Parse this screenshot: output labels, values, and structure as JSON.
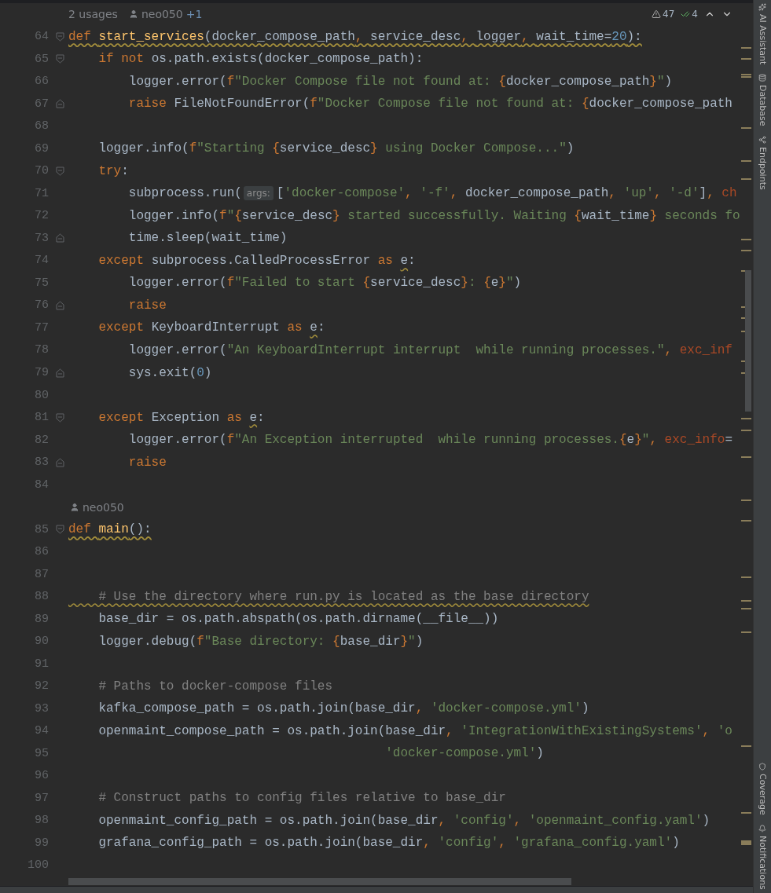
{
  "header": {
    "usages": "2 usages",
    "author": "neo050",
    "coauthors": "+1"
  },
  "inspections": {
    "warnings": "47",
    "ok": "4"
  },
  "lines": [
    {
      "kind": "code",
      "n": "64",
      "fold": {
        "kind": "start"
      },
      "wavy": true,
      "tokens": [
        {
          "kind": "kw",
          "text": "def "
        },
        {
          "kind": "fn",
          "text": "start_services"
        },
        {
          "kind": "p",
          "text": "(docker_compose_path"
        },
        {
          "kind": "kw",
          "text": ", "
        },
        {
          "kind": "p",
          "text": "service_desc"
        },
        {
          "kind": "kw",
          "text": ", "
        },
        {
          "kind": "p",
          "text": "logger"
        },
        {
          "kind": "kw",
          "text": ", "
        },
        {
          "kind": "p",
          "text": "wait_time="
        },
        {
          "kind": "num",
          "text": "20"
        },
        {
          "kind": "p",
          "text": "):"
        }
      ]
    },
    {
      "kind": "code",
      "n": "65",
      "fold": {
        "kind": "start"
      },
      "tokens": [
        {
          "kind": "kw",
          "text": "    if not "
        },
        {
          "kind": "p",
          "text": "os.path.exists(docker_compose_path):"
        }
      ]
    },
    {
      "kind": "code",
      "n": "66",
      "tokens": [
        {
          "kind": "p",
          "text": "        logger.error("
        },
        {
          "kind": "kw",
          "text": "f"
        },
        {
          "kind": "str",
          "text": "\"Docker Compose file not found at: "
        },
        {
          "kind": "kw",
          "text": "{"
        },
        {
          "kind": "p",
          "text": "docker_compose_path"
        },
        {
          "kind": "kw",
          "text": "}"
        },
        {
          "kind": "str",
          "text": "\""
        },
        {
          "kind": "p",
          "text": ")"
        }
      ]
    },
    {
      "kind": "code",
      "n": "67",
      "fold": {
        "kind": "end"
      },
      "tokens": [
        {
          "kind": "kw",
          "text": "        raise "
        },
        {
          "kind": "p",
          "text": "FileNotFoundError("
        },
        {
          "kind": "kw",
          "text": "f"
        },
        {
          "kind": "str",
          "text": "\"Docker Compose file not found at: "
        },
        {
          "kind": "kw",
          "text": "{"
        },
        {
          "kind": "p",
          "text": "docker_compose_path"
        }
      ]
    },
    {
      "kind": "code",
      "n": "68"
    },
    {
      "kind": "code",
      "n": "69",
      "tokens": [
        {
          "kind": "p",
          "text": "    logger.info("
        },
        {
          "kind": "kw",
          "text": "f"
        },
        {
          "kind": "str",
          "text": "\"Starting "
        },
        {
          "kind": "kw",
          "text": "{"
        },
        {
          "kind": "p",
          "text": "service_desc"
        },
        {
          "kind": "kw",
          "text": "}"
        },
        {
          "kind": "str",
          "text": " using Docker Compose...\""
        },
        {
          "kind": "p",
          "text": ")"
        }
      ]
    },
    {
      "kind": "code",
      "n": "70",
      "fold": {
        "kind": "start"
      },
      "tokens": [
        {
          "kind": "kw",
          "text": "    try"
        },
        {
          "kind": "p",
          "text": ":"
        }
      ]
    },
    {
      "kind": "code",
      "n": "71",
      "tokens": [
        {
          "kind": "p",
          "text": "        subprocess.run("
        },
        {
          "kind": "hint",
          "text": "args:"
        },
        {
          "kind": "p",
          "text": "["
        },
        {
          "kind": "str",
          "text": "'docker-compose'"
        },
        {
          "kind": "kw",
          "text": ", "
        },
        {
          "kind": "str",
          "text": "'-f'"
        },
        {
          "kind": "kw",
          "text": ", "
        },
        {
          "kind": "p",
          "text": "docker_compose_path"
        },
        {
          "kind": "kw",
          "text": ", "
        },
        {
          "kind": "str",
          "text": "'up'"
        },
        {
          "kind": "kw",
          "text": ", "
        },
        {
          "kind": "str",
          "text": "'-d'"
        },
        {
          "kind": "p",
          "text": "]"
        },
        {
          "kind": "kw",
          "text": ", "
        },
        {
          "kind": "kwarg",
          "text": "ch"
        }
      ]
    },
    {
      "kind": "code",
      "n": "72",
      "tokens": [
        {
          "kind": "p",
          "text": "        logger.info("
        },
        {
          "kind": "kw",
          "text": "f"
        },
        {
          "kind": "str",
          "text": "\""
        },
        {
          "kind": "kw",
          "text": "{"
        },
        {
          "kind": "p",
          "text": "service_desc"
        },
        {
          "kind": "kw",
          "text": "}"
        },
        {
          "kind": "str",
          "text": " started successfully. Waiting "
        },
        {
          "kind": "kw",
          "text": "{"
        },
        {
          "kind": "p",
          "text": "wait_time"
        },
        {
          "kind": "kw",
          "text": "}"
        },
        {
          "kind": "str",
          "text": " seconds fo"
        }
      ]
    },
    {
      "kind": "code",
      "n": "73",
      "fold": {
        "kind": "end"
      },
      "tokens": [
        {
          "kind": "p",
          "text": "        time.sleep(wait_time)"
        }
      ]
    },
    {
      "kind": "code",
      "n": "74",
      "tokens": [
        {
          "kind": "kw",
          "text": "    except "
        },
        {
          "kind": "p",
          "text": "subprocess.CalledProcessError "
        },
        {
          "kind": "kw",
          "text": "as "
        },
        {
          "kind": "p",
          "text": "e",
          "wavy": true
        },
        {
          "kind": "p",
          "text": ":"
        }
      ]
    },
    {
      "kind": "code",
      "n": "75",
      "tokens": [
        {
          "kind": "p",
          "text": "        logger.error("
        },
        {
          "kind": "kw",
          "text": "f"
        },
        {
          "kind": "str",
          "text": "\"Failed to start "
        },
        {
          "kind": "kw",
          "text": "{"
        },
        {
          "kind": "p",
          "text": "service_desc"
        },
        {
          "kind": "kw",
          "text": "}"
        },
        {
          "kind": "str",
          "text": ": "
        },
        {
          "kind": "kw",
          "text": "{"
        },
        {
          "kind": "p",
          "text": "e"
        },
        {
          "kind": "kw",
          "text": "}"
        },
        {
          "kind": "str",
          "text": "\""
        },
        {
          "kind": "p",
          "text": ")"
        }
      ]
    },
    {
      "kind": "code",
      "n": "76",
      "fold": {
        "kind": "end"
      },
      "tokens": [
        {
          "kind": "kw",
          "text": "        raise"
        }
      ]
    },
    {
      "kind": "code",
      "n": "77",
      "tokens": [
        {
          "kind": "kw",
          "text": "    except "
        },
        {
          "kind": "p",
          "text": "KeyboardInterrupt "
        },
        {
          "kind": "kw",
          "text": "as "
        },
        {
          "kind": "p",
          "text": "e",
          "wavy": true
        },
        {
          "kind": "p",
          "text": ":"
        }
      ]
    },
    {
      "kind": "code",
      "n": "78",
      "tokens": [
        {
          "kind": "p",
          "text": "        logger.error("
        },
        {
          "kind": "str",
          "text": "\"An KeyboardInterrupt interrupt  while running processes.\""
        },
        {
          "kind": "kw",
          "text": ", "
        },
        {
          "kind": "kwarg",
          "text": "exc_inf"
        }
      ]
    },
    {
      "kind": "code",
      "n": "79",
      "fold": {
        "kind": "end"
      },
      "tokens": [
        {
          "kind": "p",
          "text": "        sys.exit("
        },
        {
          "kind": "num",
          "text": "0"
        },
        {
          "kind": "p",
          "text": ")"
        }
      ]
    },
    {
      "kind": "code",
      "n": "80"
    },
    {
      "kind": "code",
      "n": "81",
      "fold": {
        "kind": "start"
      },
      "tokens": [
        {
          "kind": "kw",
          "text": "    except "
        },
        {
          "kind": "p",
          "text": "Exception "
        },
        {
          "kind": "kw",
          "text": "as "
        },
        {
          "kind": "p",
          "text": "e",
          "wavy": true
        },
        {
          "kind": "p",
          "text": ":"
        }
      ]
    },
    {
      "kind": "code",
      "n": "82",
      "tokens": [
        {
          "kind": "p",
          "text": "        logger.error("
        },
        {
          "kind": "kw",
          "text": "f"
        },
        {
          "kind": "str",
          "text": "\"An Exception interrupted  while running processes."
        },
        {
          "kind": "kw",
          "text": "{"
        },
        {
          "kind": "p",
          "text": "e"
        },
        {
          "kind": "kw",
          "text": "}"
        },
        {
          "kind": "str",
          "text": "\""
        },
        {
          "kind": "kw",
          "text": ", "
        },
        {
          "kind": "kwarg",
          "text": "exc_info"
        },
        {
          "kind": "p",
          "text": "="
        }
      ]
    },
    {
      "kind": "code",
      "n": "83",
      "fold": {
        "kind": "end"
      },
      "tokens": [
        {
          "kind": "kw",
          "text": "        raise"
        }
      ]
    },
    {
      "kind": "code",
      "n": "84"
    },
    {
      "kind": "author",
      "author": "neo050"
    },
    {
      "kind": "code",
      "n": "85",
      "fold": {
        "kind": "start"
      },
      "wavy": true,
      "tokens": [
        {
          "kind": "kw",
          "text": "def "
        },
        {
          "kind": "fn",
          "text": "main"
        },
        {
          "kind": "p",
          "text": "():"
        }
      ]
    },
    {
      "kind": "code",
      "n": "86"
    },
    {
      "kind": "code",
      "n": "87"
    },
    {
      "kind": "code",
      "n": "88",
      "tokens": [
        {
          "kind": "cm",
          "text": "    # Use the directory where run.py is located as the base directory",
          "wavy": true
        }
      ]
    },
    {
      "kind": "code",
      "n": "89",
      "tokens": [
        {
          "kind": "p",
          "text": "    base_dir = os.path.abspath(os.path.dirname(__file__))"
        }
      ]
    },
    {
      "kind": "code",
      "n": "90",
      "tokens": [
        {
          "kind": "p",
          "text": "    logger.debug("
        },
        {
          "kind": "kw",
          "text": "f"
        },
        {
          "kind": "str",
          "text": "\"Base directory: "
        },
        {
          "kind": "kw",
          "text": "{"
        },
        {
          "kind": "p",
          "text": "base_dir"
        },
        {
          "kind": "kw",
          "text": "}"
        },
        {
          "kind": "str",
          "text": "\""
        },
        {
          "kind": "p",
          "text": ")"
        }
      ]
    },
    {
      "kind": "code",
      "n": "91"
    },
    {
      "kind": "code",
      "n": "92",
      "tokens": [
        {
          "kind": "cm",
          "text": "    # Paths to docker-compose files"
        }
      ]
    },
    {
      "kind": "code",
      "n": "93",
      "tokens": [
        {
          "kind": "p",
          "text": "    kafka_compose_path = os.path.join(base_dir"
        },
        {
          "kind": "kw",
          "text": ", "
        },
        {
          "kind": "str",
          "text": "'docker-compose.yml'"
        },
        {
          "kind": "p",
          "text": ")"
        }
      ]
    },
    {
      "kind": "code",
      "n": "94",
      "tokens": [
        {
          "kind": "p",
          "text": "    openmaint_compose_path = os.path.join(base_dir"
        },
        {
          "kind": "kw",
          "text": ", "
        },
        {
          "kind": "str",
          "text": "'IntegrationWithExistingSystems'"
        },
        {
          "kind": "kw",
          "text": ", "
        },
        {
          "kind": "str",
          "text": "'o"
        }
      ]
    },
    {
      "kind": "code",
      "n": "95",
      "tokens": [
        {
          "kind": "str",
          "text": "                                          'docker-compose.yml'"
        },
        {
          "kind": "p",
          "text": ")"
        }
      ]
    },
    {
      "kind": "code",
      "n": "96"
    },
    {
      "kind": "code",
      "n": "97",
      "tokens": [
        {
          "kind": "cm",
          "text": "    # Construct paths to config files relative to base_dir"
        }
      ]
    },
    {
      "kind": "code",
      "n": "98",
      "tokens": [
        {
          "kind": "p",
          "text": "    openmaint_config_path = os.path.join(base_dir"
        },
        {
          "kind": "kw",
          "text": ", "
        },
        {
          "kind": "str",
          "text": "'config'"
        },
        {
          "kind": "kw",
          "text": ", "
        },
        {
          "kind": "str",
          "text": "'openmaint_config.yaml'"
        },
        {
          "kind": "p",
          "text": ")"
        }
      ]
    },
    {
      "kind": "code",
      "n": "99",
      "tokens": [
        {
          "kind": "p",
          "text": "    grafana_config_path = os.path.join(base_dir"
        },
        {
          "kind": "kw",
          "text": ", "
        },
        {
          "kind": "str",
          "text": "'config'"
        },
        {
          "kind": "kw",
          "text": ", "
        },
        {
          "kind": "str",
          "text": "'grafana_config.yaml'"
        },
        {
          "kind": "p",
          "text": ")"
        }
      ]
    },
    {
      "kind": "code",
      "n": "100"
    }
  ],
  "tool_windows_top": [
    {
      "label": "AI Assistant"
    },
    {
      "label": "Database"
    },
    {
      "label": "Endpoints"
    }
  ],
  "tool_windows_bottom": [
    {
      "label": "Coverage"
    },
    {
      "label": "Notifications"
    }
  ]
}
